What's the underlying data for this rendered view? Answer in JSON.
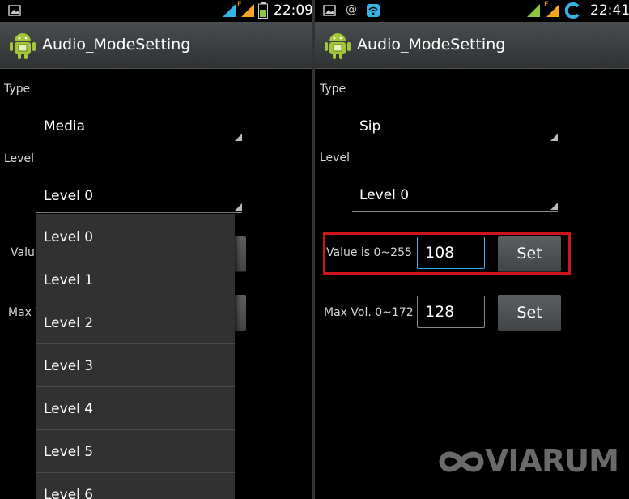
{
  "colors": {
    "focus_accent": "#33b5e5",
    "highlight_red": "#d0141c",
    "battery_green": "#8dc63f",
    "signal_orange": "#f5a623"
  },
  "left": {
    "status": {
      "time": "22:09",
      "icons": [
        "image-icon",
        "signal-icon",
        "data-e-icon",
        "signal-icon",
        "battery-icon"
      ],
      "data_indicator": "E"
    },
    "title": "Audio_ModeSetting",
    "type_label": "Type",
    "type_value": "Media",
    "level_label": "Level",
    "level_value": "Level 0",
    "value_label_partial": "Valu",
    "maxvol_label_partial": "Max V",
    "dropdown": [
      "Level 0",
      "Level 1",
      "Level 2",
      "Level 3",
      "Level 4",
      "Level 5",
      "Level 6"
    ]
  },
  "right": {
    "status": {
      "time": "22:41",
      "icons": [
        "image-icon",
        "at-icon",
        "wifi-icon",
        "signal-icon",
        "data-e-icon",
        "signal-icon",
        "sync-icon"
      ],
      "at": "@",
      "data_indicator": "E"
    },
    "title": "Audio_ModeSetting",
    "type_label": "Type",
    "type_value": "Sip",
    "level_label": "Level",
    "level_value": "Level 0",
    "value_label": "Value is 0~255",
    "value_input": "108",
    "set_label": "Set",
    "maxvol_label": "Max Vol. 0~172",
    "maxvol_input": "128",
    "set2_label": "Set"
  },
  "watermark": "VIARUM"
}
